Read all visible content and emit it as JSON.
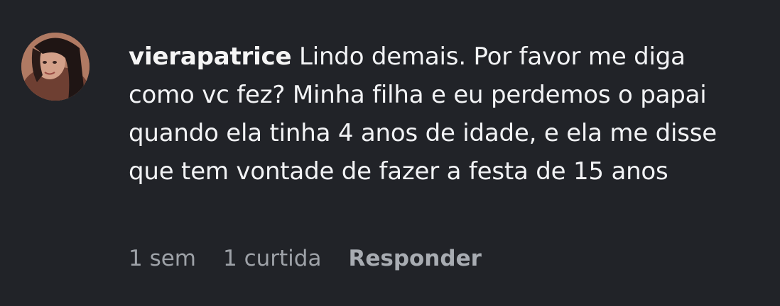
{
  "comment": {
    "username": "vierapatrice",
    "text": "Lindo demais. Por favor me diga como vc fez? Minha filha e eu perdemos o papai quando ela tinha 4 anos de idade, e ela me disse que tem vontade de fazer a festa de 15 anos",
    "time": "1 sem",
    "likes": "1 curtida",
    "reply_label": "Responder"
  },
  "colors": {
    "background": "#212328",
    "text": "#f2f3f5",
    "meta": "#9ea2a8"
  }
}
